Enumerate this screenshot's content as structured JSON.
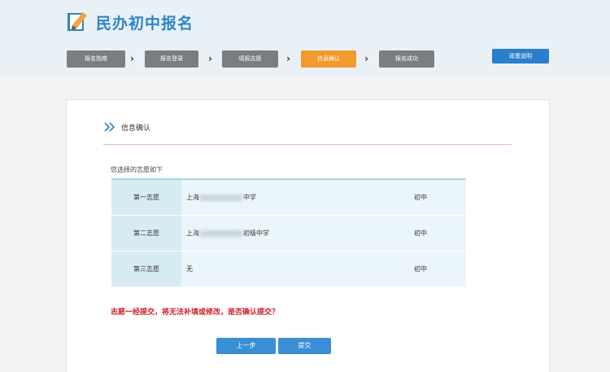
{
  "header": {
    "title": "民办初中报名",
    "policy_label": "政策说明"
  },
  "steps": [
    {
      "label": "报名指南"
    },
    {
      "label": "报名登录"
    },
    {
      "label": "填报志愿"
    },
    {
      "label": "信息确认",
      "active": true
    },
    {
      "label": "报名成功"
    }
  ],
  "step_separator": "›",
  "section": {
    "title": "信息确认",
    "intro": "您选择的志愿如下"
  },
  "volunteers": [
    {
      "rank": "第一志愿",
      "prefix": "上海",
      "suffix": "中学",
      "level": "初中"
    },
    {
      "rank": "第二志愿",
      "prefix": "上海",
      "suffix": "初级中学",
      "level": "初中"
    },
    {
      "rank": "第三志愿",
      "prefix": "无",
      "suffix": "",
      "level": "初中"
    }
  ],
  "warning": "志愿一经提交，将无法补填或修改，是否确认提交？",
  "buttons": {
    "prev": "上一步",
    "submit": "提交"
  },
  "colors": {
    "brand": "#2f84c6",
    "active_step": "#f39a2e",
    "inactive_step": "#7c7d80",
    "warning": "#d0202a",
    "button": "#3a8ed5"
  }
}
